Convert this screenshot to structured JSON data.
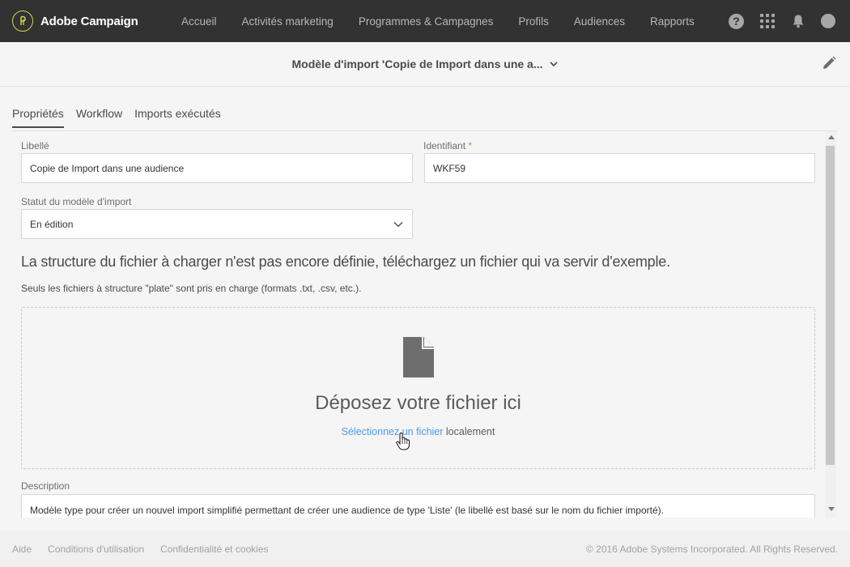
{
  "app": {
    "brand": "Adobe Campaign"
  },
  "nav": {
    "items": [
      "Accueil",
      "Activités marketing",
      "Programmes & Campagnes",
      "Profils",
      "Audiences",
      "Rapports"
    ],
    "help_glyph": "?"
  },
  "header": {
    "title": "Modèle d'import 'Copie de Import dans une a..."
  },
  "tabs": [
    "Propriétés",
    "Workflow",
    "Imports exécutés"
  ],
  "form": {
    "libelle_label": "Libellé",
    "libelle_value": "Copie de Import dans une audience",
    "identifiant_label": "Identifiant",
    "required_marker": "*",
    "identifiant_value": "WKF59",
    "statut_label": "Statut du modèle d'import",
    "statut_value": "En édition",
    "description_label": "Description",
    "description_value": "Modèle type pour créer un nouvel import simplifié permettant de créer une audience de type 'Liste' (le libellé est basé sur le nom du fichier importé)."
  },
  "upload": {
    "headline": "La structure du fichier à charger n'est pas encore définie, téléchargez un fichier qui va servir d'exemple.",
    "note": "Seuls les fichiers à structure \"plate\" sont pris en charge (formats .txt, .csv, etc.).",
    "drop_title": "Déposez votre fichier ici",
    "select_link": "Sélectionnez un fichier",
    "select_suffix": "localement"
  },
  "footer": {
    "links": [
      "Aide",
      "Conditions d'utilisation",
      "Confidentialité et cookies"
    ],
    "copyright": "© 2016 Adobe Systems Incorporated. All Rights Reserved."
  }
}
